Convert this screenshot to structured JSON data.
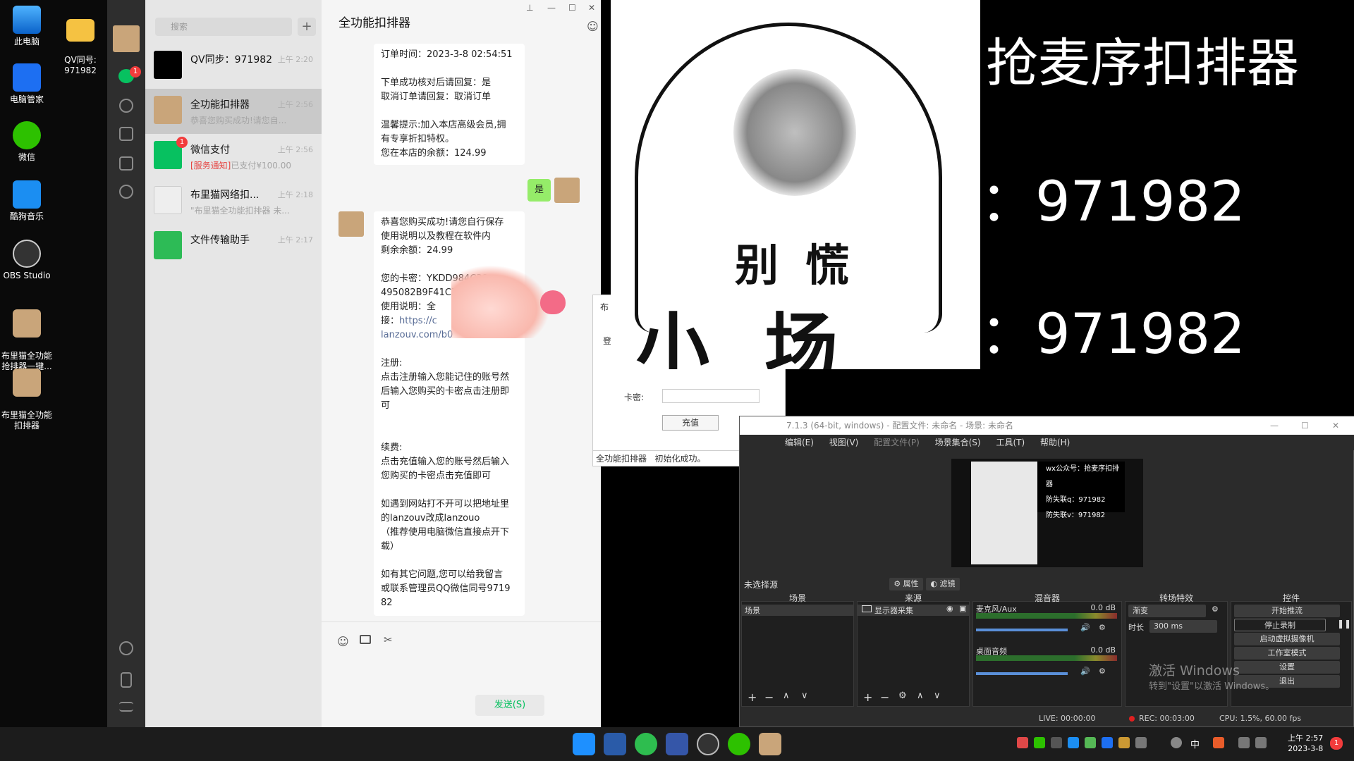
{
  "desktop": {
    "icons": [
      {
        "label": "此电脑"
      },
      {
        "label": "QV同号:\n971982"
      },
      {
        "label": "电脑管家"
      },
      {
        "label": "微信"
      },
      {
        "label": "酷狗音乐"
      },
      {
        "label": "OBS Studio"
      },
      {
        "label": "布里猫全功能\n抢排器一键..."
      },
      {
        "label": "布里猫全功能\n扣排器"
      }
    ]
  },
  "wechat": {
    "search_placeholder": "搜索",
    "add": "+",
    "unread_badge": "1",
    "conversations": [
      {
        "name": "QV同步：971982",
        "time": "上午 2:20",
        "preview": ""
      },
      {
        "name": "全功能扣排器",
        "time": "上午 2:56",
        "preview": "恭喜您购买成功!请您自..."
      },
      {
        "name": "微信支付",
        "time": "上午 2:56",
        "preview_tag": "[服务通知]",
        "preview": "已支付¥100.00",
        "badge": "1"
      },
      {
        "name": "布里猫网络扣...",
        "time": "上午 2:18",
        "preview": "\"布里猫全功能扣排器 未..."
      },
      {
        "name": "文件传输助手",
        "time": "上午 2:17",
        "preview": ""
      }
    ],
    "chat_title": "全功能扣排器",
    "msg1": "订单时间：2023-3-8 02:54:51\n\n下单成功核对后请回复：是\n取消订单请回复：取消订单\n\n温馨提示:加入本店高级会员,拥\n有专享折扣特权。\n您在本店的余额：124.99",
    "my_reply": "是",
    "msg2_a": "恭喜您购买成功!请您自行保存\n使用说明以及教程在软件内\n剩余余额：24.99\n\n您的卡密：YKDD984",
    "msg2_a2": "C38\n495082B9F41C7",
    "msg2_b": "使用说明：全\n接：",
    "msg2_link": "https://c",
    "msg2_link2": "lanzouv.com/b0",
    "msg2_c": "注册:\n点击注册输入您能记住的账号然\n后输入您购买的卡密点击注册即\n可\n\n\n续费:\n点击充值输入您的账号然后输入\n您购买的卡密点击充值即可\n\n如遇到网站打不开可以把地址里\n的lanzouv改成lanzouo\n（推荐使用电脑微信直接点开下\n载）\n\n如有其它问题,您可以给我留言\n或联系管理员QQ微信同号9719\n82",
    "send": "发送(S)"
  },
  "meme": {
    "caption1": "别慌",
    "caption2": "小场面"
  },
  "overlay": {
    "title": "抢麦序扣排器",
    "line1": "：971982",
    "line2": "：971982"
  },
  "popup": {
    "title_frag": "布",
    "login_frag": "登",
    "card_label": "卡密:",
    "recharge": "充值",
    "status_app": "全功能扣排器",
    "status_msg": "初始化成功。"
  },
  "obs": {
    "title": "7.1.3 (64-bit, windows) - 配置文件: 未命名 - 场景: 未命名",
    "menu": [
      "编辑(E)",
      "视图(V)",
      "配置文件(P)",
      "场景集合(S)",
      "工具(T)",
      "帮助(H)"
    ],
    "preview_lines": [
      "wx公众号：抢麦序扣排器",
      "防失联q：971982",
      "防失联v：971982"
    ],
    "no_source": "未选择源",
    "properties": "属性",
    "filters": "滤镜",
    "panels": {
      "scenes": "场景",
      "sources": "来源",
      "mixer": "混音器",
      "transitions": "转场特效",
      "controls": "控件"
    },
    "scene_item": "场景",
    "source_item": "显示器采集",
    "mic": "麦克风/Aux",
    "mic_db": "0.0 dB",
    "desktop_audio": "桌面音频",
    "desktop_db": "0.0 dB",
    "transition": "渐变",
    "duration_label": "时长",
    "duration": "300 ms",
    "controls_list": [
      "开始推流",
      "停止录制",
      "启动虚拟摄像机",
      "工作室模式",
      "设置",
      "退出"
    ],
    "activate1": "激活 Windows",
    "activate2": "转到\"设置\"以激活 Windows。",
    "status_live": "LIVE: 00:00:00",
    "status_rec": "REC: 00:03:00",
    "status_cpu": "CPU: 1.5%, 60.00 fps"
  },
  "taskbar": {
    "ime": "中",
    "time": "上午 2:57",
    "date": "2023-3-8",
    "notif": "1"
  }
}
